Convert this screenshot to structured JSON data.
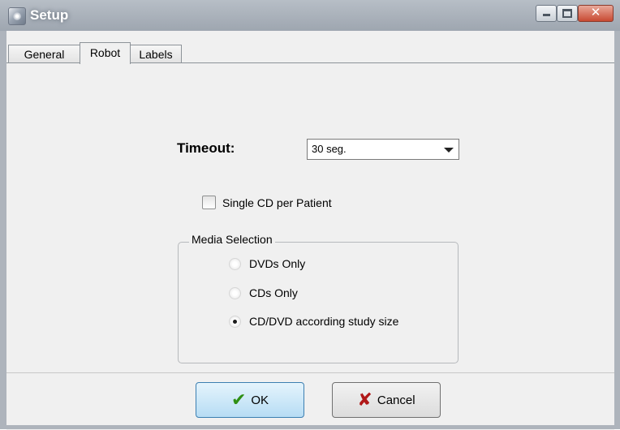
{
  "window": {
    "title": "Setup"
  },
  "tabs": [
    {
      "label": "General",
      "active": false
    },
    {
      "label": "Robot",
      "active": true
    },
    {
      "label": "Labels",
      "active": false
    }
  ],
  "robot": {
    "timeout_label": "Timeout:",
    "timeout_value": "30 seg.",
    "single_cd_label": "Single CD per Patient",
    "single_cd_checked": false,
    "media_selection": {
      "title": "Media Selection",
      "options": [
        {
          "label": "DVDs Only",
          "selected": false
        },
        {
          "label": "CDs Only",
          "selected": false
        },
        {
          "label": "CD/DVD according study size",
          "selected": true
        }
      ]
    }
  },
  "buttons": {
    "ok_label": "OK",
    "cancel_label": "Cancel"
  }
}
